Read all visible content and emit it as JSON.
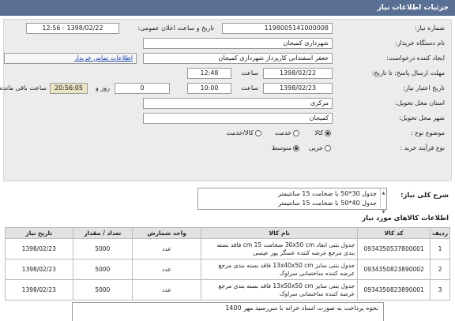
{
  "header": {
    "title": "جزئیات اطلاعات نیاز"
  },
  "fields": {
    "need_number_label": "شماره نیاز:",
    "need_number": "1198005141000008",
    "announce_label": "تاریخ و ساعت اعلان عمومی:",
    "announce_value": "1398/02/22 - 12:56",
    "buyer_label": "نام دستگاه خریدار:",
    "buyer_value": "شهرداری کمیجان",
    "creator_label": "ایجاد کننده درخواست:",
    "creator_value": "جعفر  اسفندانی  کارپرداز شهرداری کمیجان",
    "contact_link": "اطلاعات تماس خریدار",
    "send_deadline_label": "مهلت ارسال پاسخ: تا تاریخ:",
    "send_date": "1398/02/22",
    "time_label": "ساعت",
    "send_time": "12:48",
    "validity_label": "تاریخ اعتبار نیاز:",
    "validity_date": "1398/02/23",
    "validity_time": "10:00",
    "days_value": "0",
    "days_label": "روز و",
    "remaining_time": "20:56:05",
    "remaining_label": "ساعت باقی مانده",
    "province_label": "استان محل تحویل:",
    "province_value": "مرکزی",
    "city_label": "شهر محل تحویل:",
    "city_value": "کمیجان",
    "category_label": "موضوع نوع :",
    "category_options": [
      "کالا",
      "خدمت",
      "کالا/خدمت"
    ],
    "process_label": "نوع فرآیند خرید :",
    "process_options": [
      "جزیی",
      "متوسط"
    ]
  },
  "description": {
    "label": "شرح کلی نیاز:",
    "lines": [
      "جدول 30*50 با ضخامت 15 سانتیمتر",
      "جدول 40*50 با ضخامت 15 سانتیمتر"
    ]
  },
  "goods": {
    "title": "اطلاعات کالاهای مورد نیاز",
    "headers": [
      "ردیف",
      "کد کالا",
      "نام کالا",
      "واحد شمارش",
      "تعداد / مقدار",
      "تاریخ نیاز"
    ],
    "rows": [
      {
        "idx": "1",
        "code": "0934350537800001",
        "name": "جدول بتنی ابعاد 30x50 cm ضخامت 15 cm فاقد بسته بندی مرجع عرضه کننده عسگر پور عیسی",
        "unit": "عدد",
        "qty": "5000",
        "date": "1398/02/23"
      },
      {
        "idx": "2",
        "code": "0934350823890002",
        "name": "جدول بتنی سایز 13x40x50 cm فاقد بسته بندی مرجع عرضه کننده ساختمانی سراوک",
        "unit": "عدد",
        "qty": "5000",
        "date": "1398/02/23"
      },
      {
        "idx": "3",
        "code": "0934350823890001",
        "name": "جدول بتنی سایز 13x50x50 cm فاقد بسته بندی مرجع عرضه کننده ساختمانی سراوک",
        "unit": "عدد",
        "qty": "5000",
        "date": "1398/02/23"
      }
    ]
  },
  "note": {
    "text": "نحوه پرداخت به صورت اسناد خزانه با سررسید مهر 1400"
  }
}
